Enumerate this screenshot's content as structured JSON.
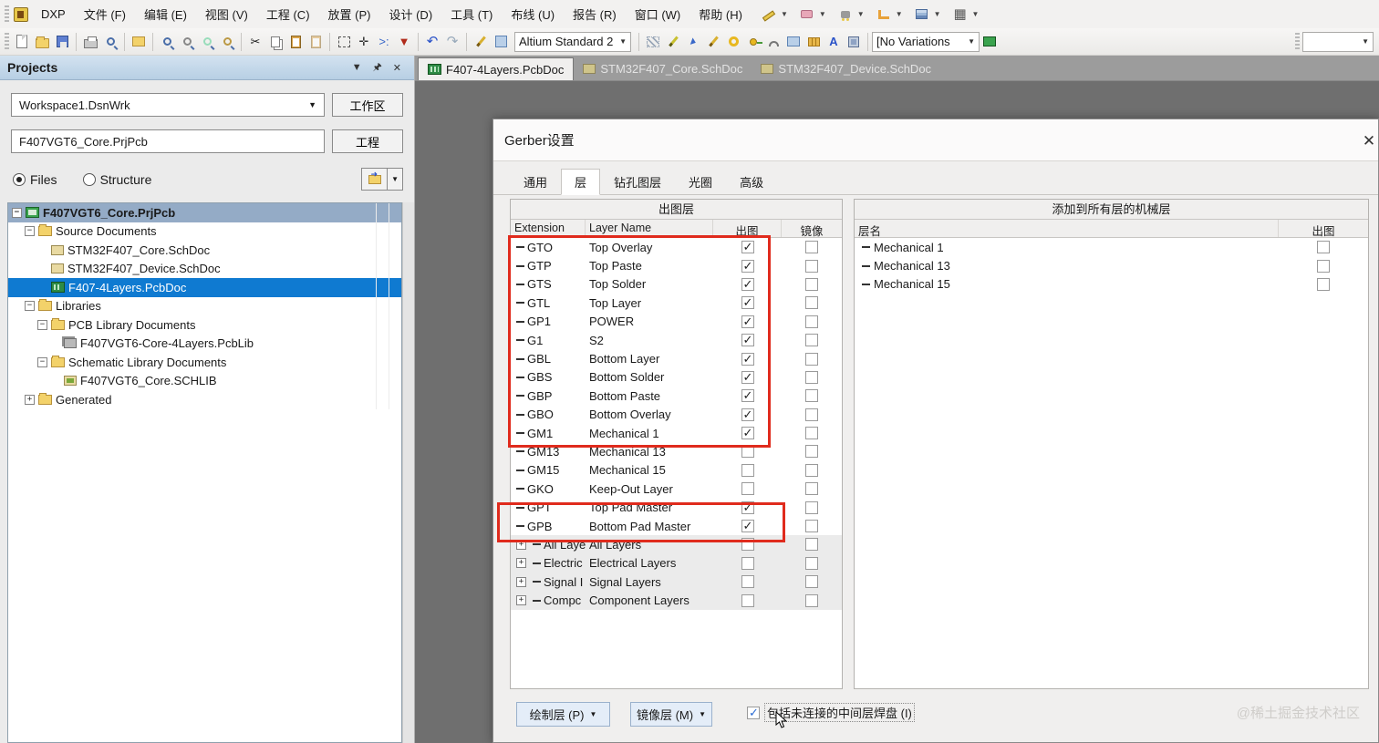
{
  "menubar": {
    "app_button": "DXP",
    "items": [
      "文件 (F)",
      "编辑 (E)",
      "视图 (V)",
      "工程 (C)",
      "放置 (P)",
      "设计 (D)",
      "工具 (T)",
      "布线 (U)",
      "报告 (R)",
      "窗口 (W)",
      "帮助 (H)"
    ],
    "tool_icons": [
      "measure-tool-icon",
      "pad-tool-icon",
      "find-tool-icon",
      "route-tool-icon",
      "layer-stack-icon",
      "grid-tool-icon"
    ]
  },
  "toolbar": {
    "style_combo_value": "Altium Standard 2",
    "variations_combo_value": "[No Variations",
    "right_combo_value": "",
    "icon_groups_row2": [
      [
        "new-document-icon",
        "open-document-icon",
        "save-icon"
      ],
      [
        "print-icon",
        "print-preview-icon"
      ],
      [
        "window-icon"
      ],
      [
        "zoom-document-icon",
        "zoom-area-icon",
        "zoom-out-icon",
        "zoom-filter-icon"
      ],
      [
        "cut-icon",
        "copy-icon",
        "paste-icon",
        "paste-array-icon"
      ],
      [
        "select-rect-icon",
        "move-icon",
        "cross-probe-icon",
        "clear-filter-icon"
      ],
      [
        "undo-icon",
        "redo-icon"
      ],
      [
        "interactive-wire-icon",
        "browse-library-icon"
      ]
    ],
    "icon_group_place": [
      "hatch-fill-icon",
      "wire-icon",
      "cursor-probe-icon",
      "pencil-probe-icon",
      "donut-pad-icon",
      "via-pin-icon",
      "arc-icon",
      "fill-rect-icon",
      "pad-array-icon",
      "text-string-icon",
      "component-icon"
    ],
    "glyphs": {
      "cut": "✂",
      "undo": "↶",
      "redo": "↷",
      "grid": "▦",
      "text": "A"
    }
  },
  "doc_tabs": [
    {
      "label": "F407-4Layers.PcbDoc",
      "type": "pcb",
      "active": true
    },
    {
      "label": "STM32F407_Core.SchDoc",
      "type": "sch",
      "active": false
    },
    {
      "label": "STM32F407_Device.SchDoc",
      "type": "sch",
      "active": false
    }
  ],
  "projects_panel": {
    "title": "Projects",
    "header_icons": [
      "dropdown-icon",
      "pin-icon",
      "close-icon"
    ],
    "workspace_combo_value": "Workspace1.DsnWrk",
    "workspace_button": "工作区",
    "project_field_value": "F407VGT6_Core.PrjPcb",
    "project_button": "工程",
    "radio_files_label": "Files",
    "radio_structure_label": "Structure",
    "tree": [
      {
        "label": "F407VGT6_Core.PrjPcb",
        "depth": 0,
        "icon": "prj",
        "expand": "minus",
        "style": "proj"
      },
      {
        "label": "Source Documents",
        "depth": 1,
        "icon": "folder",
        "expand": "minus"
      },
      {
        "label": "STM32F407_Core.SchDoc",
        "depth": 2,
        "icon": "schdoc",
        "expand": "none"
      },
      {
        "label": "STM32F407_Device.SchDoc",
        "depth": 2,
        "icon": "schdoc",
        "expand": "none"
      },
      {
        "label": "F407-4Layers.PcbDoc",
        "depth": 2,
        "icon": "pcbdoc",
        "expand": "none",
        "style": "sel"
      },
      {
        "label": "Libraries",
        "depth": 1,
        "icon": "folder",
        "expand": "minus"
      },
      {
        "label": "PCB Library Documents",
        "depth": 2,
        "icon": "folder",
        "expand": "minus"
      },
      {
        "label": "F407VGT6-Core-4Layers.PcbLib",
        "depth": 3,
        "icon": "pcblib",
        "expand": "none"
      },
      {
        "label": "Schematic Library Documents",
        "depth": 2,
        "icon": "folder",
        "expand": "minus"
      },
      {
        "label": "F407VGT6_Core.SCHLIB",
        "depth": 3,
        "icon": "schlib",
        "expand": "none"
      },
      {
        "label": "Generated",
        "depth": 1,
        "icon": "folder",
        "expand": "plus"
      }
    ]
  },
  "dialog": {
    "title": "Gerber设置",
    "close_icon": "✕",
    "tabs": [
      "通用",
      "层",
      "钻孔图层",
      "光圈",
      "高级"
    ],
    "active_tab_index": 1,
    "plot_table": {
      "group_title": "出图层",
      "columns": [
        "Extension",
        "Layer Name",
        "出图",
        "镜像"
      ],
      "rows": [
        {
          "ext": "GTO",
          "name": "Top Overlay",
          "plot": true,
          "mirror": false
        },
        {
          "ext": "GTP",
          "name": "Top Paste",
          "plot": true,
          "mirror": false
        },
        {
          "ext": "GTS",
          "name": "Top Solder",
          "plot": true,
          "mirror": false
        },
        {
          "ext": "GTL",
          "name": "Top Layer",
          "plot": true,
          "mirror": false
        },
        {
          "ext": "GP1",
          "name": "POWER",
          "plot": true,
          "mirror": false
        },
        {
          "ext": "G1",
          "name": "S2",
          "plot": true,
          "mirror": false
        },
        {
          "ext": "GBL",
          "name": "Bottom Layer",
          "plot": true,
          "mirror": false
        },
        {
          "ext": "GBS",
          "name": "Bottom Solder",
          "plot": true,
          "mirror": false
        },
        {
          "ext": "GBP",
          "name": "Bottom Paste",
          "plot": true,
          "mirror": false
        },
        {
          "ext": "GBO",
          "name": "Bottom Overlay",
          "plot": true,
          "mirror": false
        },
        {
          "ext": "GM1",
          "name": "Mechanical 1",
          "plot": true,
          "mirror": false
        },
        {
          "ext": "GM13",
          "name": "Mechanical 13",
          "plot": false,
          "mirror": false
        },
        {
          "ext": "GM15",
          "name": "Mechanical 15",
          "plot": false,
          "mirror": false
        },
        {
          "ext": "GKO",
          "name": "Keep-Out Layer",
          "plot": false,
          "mirror": false
        },
        {
          "ext": "GPT",
          "name": "Top Pad Master",
          "plot": true,
          "mirror": false
        },
        {
          "ext": "GPB",
          "name": "Bottom Pad Master",
          "plot": true,
          "mirror": false
        }
      ],
      "group_rows": [
        {
          "ext": "All Laye",
          "name": "All Layers",
          "plot": false,
          "mirror": false
        },
        {
          "ext": "Electric",
          "name": "Electrical Layers",
          "plot": false,
          "mirror": false
        },
        {
          "ext": "Signal I",
          "name": "Signal Layers",
          "plot": false,
          "mirror": false
        },
        {
          "ext": "Compc",
          "name": "Component Layers",
          "plot": false,
          "mirror": false
        }
      ]
    },
    "mech_table": {
      "group_title": "添加到所有层的机械层",
      "columns": [
        "层名",
        "出图"
      ],
      "rows": [
        {
          "name": "Mechanical 1",
          "plot": false
        },
        {
          "name": "Mechanical 13",
          "plot": false
        },
        {
          "name": "Mechanical 15",
          "plot": false
        }
      ]
    },
    "buttons": {
      "plot_layers": "绘制层 (P)",
      "mirror_layers": "镜像层 (M)"
    },
    "include_unconnected_checkbox": {
      "label": "包括未连接的中间层焊盘 (I)",
      "checked": true
    }
  },
  "watermark": "@稀土掘金技术社区",
  "colors": {
    "annotation_red": "#e02b1d",
    "selection_blue": "#0f7ad1",
    "project_row_blue": "#94abc6",
    "panel_header_blue": "#c5d8ea",
    "editor_gray": "#6f6f6f"
  }
}
